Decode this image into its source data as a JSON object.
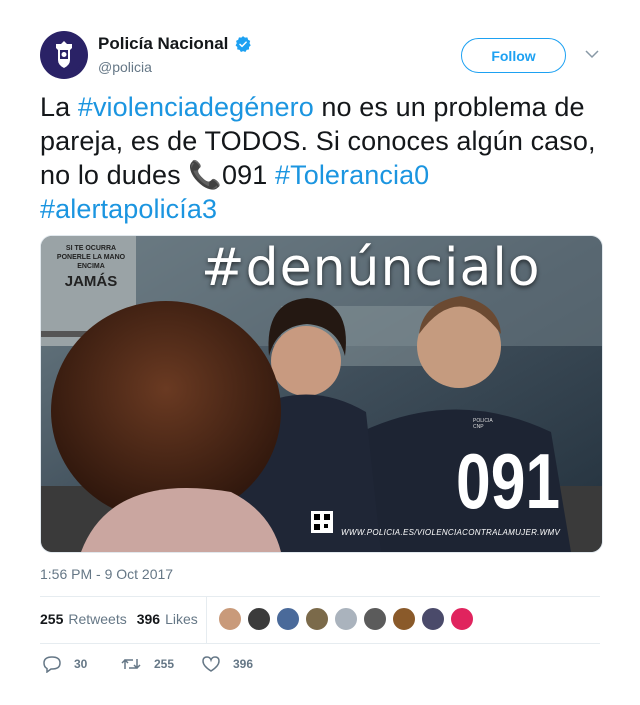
{
  "author": {
    "name": "Policía Nacional",
    "handle": "@policia",
    "verified": true
  },
  "follow_label": "Follow",
  "tweet": {
    "segments": [
      {
        "text": "La ",
        "link": false
      },
      {
        "text": "#violenciadegénero",
        "link": true
      },
      {
        "text": " no es un problema de pareja, es de TODOS. Si conoces algún caso, no lo dudes ",
        "link": false
      },
      {
        "text": "📞",
        "link": false,
        "icon": "phone-icon"
      },
      {
        "text": "091 ",
        "link": false
      },
      {
        "text": "#Tolerancia0",
        "link": true
      },
      {
        "text": " ",
        "link": false
      },
      {
        "text": "#alertapolicía3",
        "link": true
      }
    ]
  },
  "media": {
    "hashtag_text": "#denúncialo",
    "phone_number": "091",
    "url_text": "WWW.POLICIA.ES/VIOLENCIACONTRALAMUJER.WMV",
    "poster_text_line1": "SI TE OCURRA",
    "poster_text_line2": "PONERLE LA MANO ENCIMA",
    "poster_text_line3": "JAMÁS",
    "badge_text": "POLICIA CNP"
  },
  "timestamp": "1:56 PM - 9 Oct 2017",
  "stats": {
    "retweets_count": "255",
    "retweets_label": "Retweets",
    "likes_count": "396",
    "likes_label": "Likes"
  },
  "liker_avatars": [
    "#c99a7a",
    "#3b3b3b",
    "#4a6a9a",
    "#7b6a4a",
    "#aab3bd",
    "#5b5b5b",
    "#8a5a2a",
    "#4a4a6a",
    "#e0245e"
  ],
  "actions": {
    "reply_count": "30",
    "retweet_count": "255",
    "like_count": "396"
  },
  "colors": {
    "link": "#1b95e0",
    "follow": "#1da1f2",
    "muted": "#657786"
  }
}
